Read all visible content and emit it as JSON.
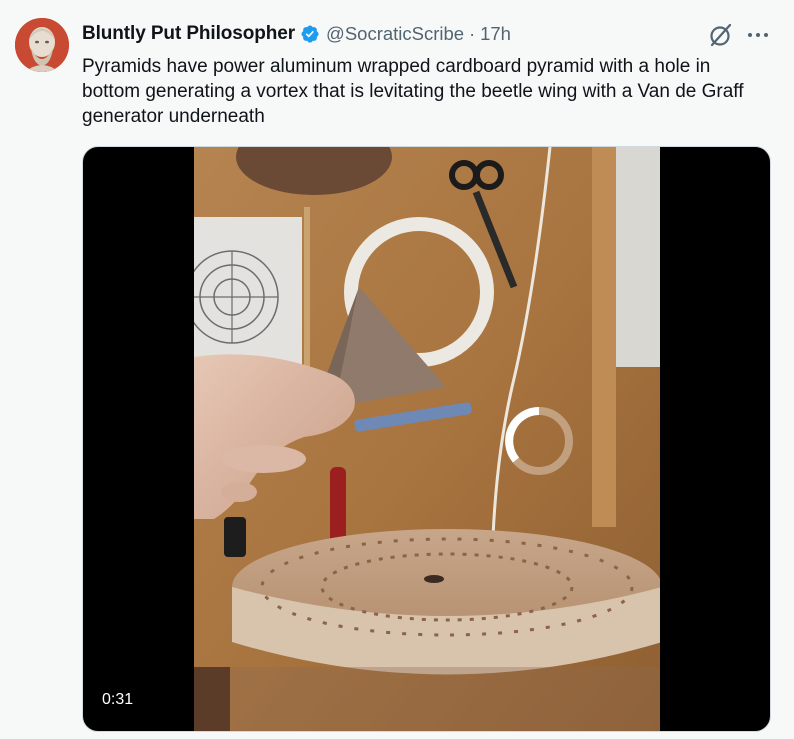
{
  "post": {
    "author": {
      "display_name": "Bluntly Put Philosopher",
      "handle": "@SocraticScribe",
      "verified": true,
      "avatar_icon": "philosopher-bust-avatar"
    },
    "separator": "·",
    "timestamp": "17h",
    "text": "Pyramids have power aluminum wrapped cardboard pyramid with a hole in bottom generating a vortex that is levitating the beetle wing with a Van de Graff generator underneath",
    "media": {
      "type": "video",
      "duration": "0:31",
      "state": "loading"
    },
    "icons": {
      "verified": "verified-badge-icon",
      "grok": "grok-icon",
      "more": "more-options-icon"
    }
  },
  "colors": {
    "text_primary": "#0f1419",
    "text_secondary": "#536471",
    "verified_blue": "#1d9bf0",
    "background": "#f7f9f9"
  }
}
